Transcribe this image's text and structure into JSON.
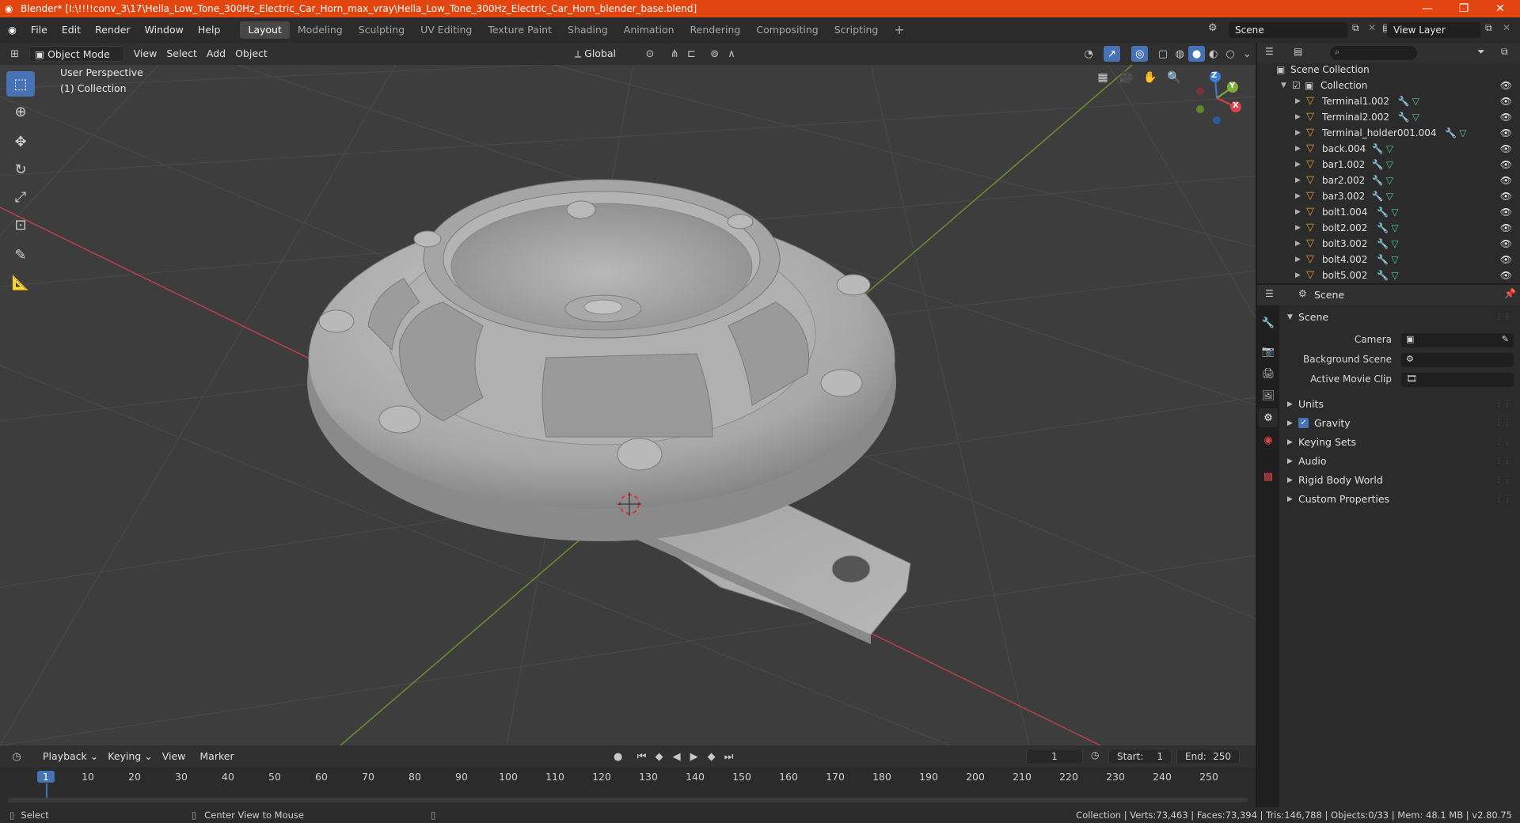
{
  "window": {
    "title": "Blender* [I:\\!!!!conv_3\\17\\Hella_Low_Tone_300Hz_Electric_Car_Horn_max_vray\\Hella_Low_Tone_300Hz_Electric_Car_Horn_blender_base.blend]",
    "minimize": "—",
    "maximize": "❐",
    "close": "✕"
  },
  "menu": [
    "File",
    "Edit",
    "Render",
    "Window",
    "Help"
  ],
  "workspaces": [
    "Layout",
    "Modeling",
    "Sculpting",
    "UV Editing",
    "Texture Paint",
    "Shading",
    "Animation",
    "Rendering",
    "Compositing",
    "Scripting"
  ],
  "active_workspace": "Layout",
  "scene_field": "Scene",
  "view_layer_field": "View Layer",
  "viewport_header": {
    "mode": "Object Mode",
    "menus": [
      "View",
      "Select",
      "Add",
      "Object"
    ],
    "transform_orientation": "Global"
  },
  "viewport": {
    "perspective": "User Perspective",
    "collection": "(1) Collection",
    "gizmo": {
      "x": "X",
      "y": "Y",
      "z": "Z"
    }
  },
  "outliner": {
    "search_placeholder": "",
    "scene_collection": "Scene Collection",
    "collection": "Collection",
    "items": [
      "Terminal1.002",
      "Terminal2.002",
      "Terminal_holder001.004",
      "back.004",
      "bar1.002",
      "bar2.002",
      "bar3.002",
      "bolt1.004",
      "bolt2.002",
      "bolt3.002",
      "bolt4.002",
      "bolt5.002"
    ]
  },
  "properties": {
    "header": "Scene",
    "panel": "Scene",
    "fields": [
      {
        "label": "Camera",
        "value": ""
      },
      {
        "label": "Background Scene",
        "value": ""
      },
      {
        "label": "Active Movie Clip",
        "value": ""
      }
    ],
    "subpanels": [
      "Units",
      "Gravity",
      "Keying Sets",
      "Audio",
      "Rigid Body World",
      "Custom Properties"
    ],
    "gravity_checked": true
  },
  "timeline": {
    "menus": [
      "Playback",
      "Keying",
      "View",
      "Marker"
    ],
    "current_frame": "1",
    "start_label": "Start:",
    "start": "1",
    "end_label": "End:",
    "end": "250",
    "ticks": [
      "1",
      "10",
      "20",
      "30",
      "40",
      "50",
      "60",
      "70",
      "80",
      "90",
      "100",
      "110",
      "120",
      "130",
      "140",
      "150",
      "160",
      "170",
      "180",
      "190",
      "200",
      "210",
      "220",
      "230",
      "240",
      "250"
    ]
  },
  "status": {
    "left_action": "Select",
    "middle_action": "Center View to Mouse",
    "stats": "Collection | Verts:73,463 | Faces:73,394 | Tris:146,788 | Objects:0/33 | Mem: 48.1 MB | v2.80.75"
  },
  "colors": {
    "titlebar": "#e2450f",
    "accent": "#4772b3",
    "object_icon": "#e89b3c",
    "x_axis": "#d9434e",
    "y_axis": "#7fae3a",
    "z_axis": "#3c7bd6"
  }
}
